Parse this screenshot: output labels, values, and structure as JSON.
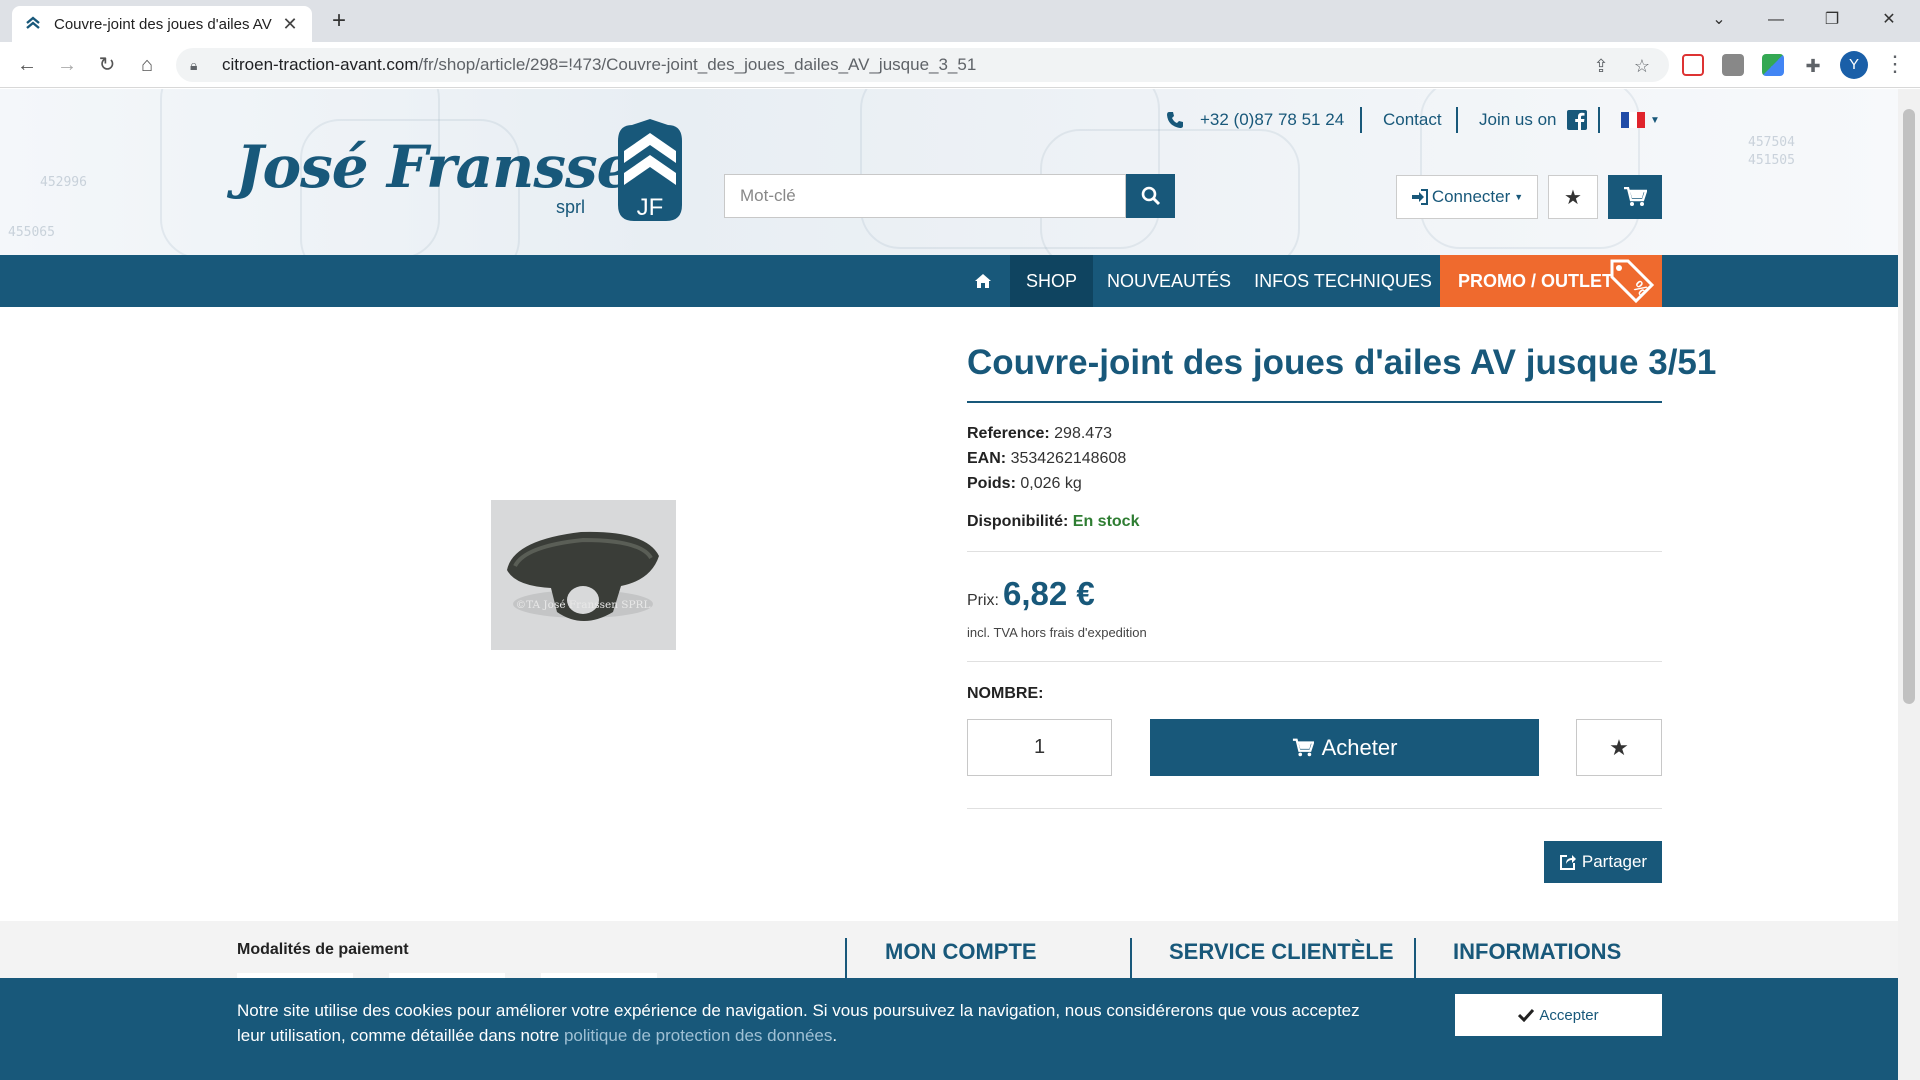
{
  "browser": {
    "tab_title": "Couvre-joint des joues d'ailes AV",
    "url_domain": "citroen-traction-avant.com",
    "url_path": "/fr/shop/article/298=!473/Couvre-joint_des_joues_dailes_AV_jusque_3_51",
    "avatar_letter": "Y"
  },
  "header": {
    "logo_name": "José Franssen",
    "logo_suffix": "sprl",
    "logo_badge": "JF",
    "phone": "+32 (0)87 78 51 24",
    "contact_label": "Contact",
    "join_label": "Join us on",
    "search_placeholder": "Mot-clé",
    "connect_label": "Connecter"
  },
  "nav": {
    "shop": "SHOP",
    "new": "NOUVEAUTÉS",
    "info": "INFOS TECHNIQUES",
    "promo": "PROMO / OUTLET"
  },
  "product": {
    "image_watermark": "©TA José Franssen SPRL",
    "title": "Couvre-joint des joues d'ailes AV jusque 3/51",
    "reference_label": "Reference:",
    "reference": "298.473",
    "ean_label": "EAN:",
    "ean": "3534262148608",
    "weight_label": "Poids:",
    "weight": "0,026 kg",
    "availability_label": "Disponibilité:",
    "availability": "En stock",
    "price_label": "Prix:",
    "price": "6,82 €",
    "price_note": "incl. TVA hors frais d'expedition",
    "quantity_label": "NOMBRE:",
    "quantity": "1",
    "buy_label": "Acheter",
    "share_label": "Partager"
  },
  "footer": {
    "payment_title": "Modalités de paiement",
    "col1": "MON COMPTE",
    "col2": "SERVICE CLIENTÈLE",
    "col3": "INFORMATIONS"
  },
  "cookie": {
    "text": "Notre site utilise des cookies pour améliorer votre expérience de navigation. Si vous poursuivez la navigation, nous considérerons que vous acceptez leur utilisation, comme détaillée dans notre ",
    "link": "politique de protection des données",
    "end": ".",
    "accept": "Accepter"
  },
  "colors": {
    "brand": "#18587a",
    "promo": "#ef6a2e",
    "stock": "#2e7d32"
  }
}
